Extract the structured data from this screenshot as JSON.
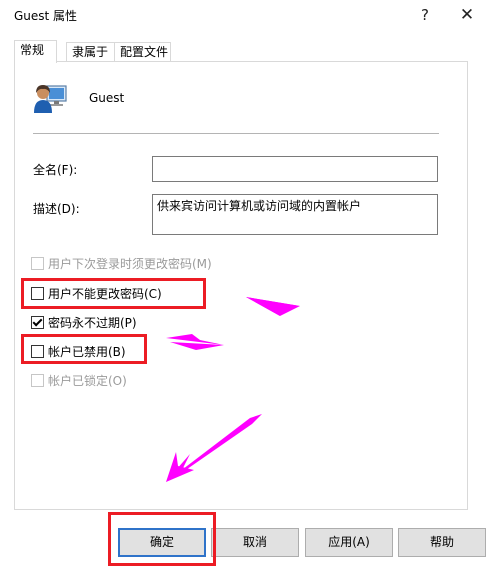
{
  "window": {
    "title": "Guest 属性",
    "help_glyph": "?",
    "close_glyph": "✕"
  },
  "tabs": [
    {
      "label": "常规",
      "active": true
    },
    {
      "label": "隶属于",
      "active": false
    },
    {
      "label": "配置文件",
      "active": false
    }
  ],
  "general": {
    "user_name": "Guest",
    "full_name_label": "全名(F):",
    "full_name_value": "",
    "description_label": "描述(D):",
    "description_value": "供来宾访问计算机或访问域的内置帐户"
  },
  "checkboxes": [
    {
      "label": "用户下次登录时须更改密码(M)",
      "checked": false,
      "enabled": false
    },
    {
      "label": "用户不能更改密码(C)",
      "checked": false,
      "enabled": true
    },
    {
      "label": "密码永不过期(P)",
      "checked": true,
      "enabled": true
    },
    {
      "label": "帐户已禁用(B)",
      "checked": false,
      "enabled": true
    },
    {
      "label": "帐户已锁定(O)",
      "checked": false,
      "enabled": false
    }
  ],
  "buttons": {
    "ok": "确定",
    "cancel": "取消",
    "apply": "应用(A)",
    "help": "帮助"
  },
  "colors": {
    "highlight": "#ec1c24",
    "arrow": "#ff00ff",
    "focus_border": "#2f73c9"
  }
}
